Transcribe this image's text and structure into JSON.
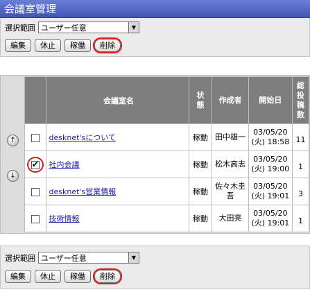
{
  "title": "会議室管理",
  "range": {
    "label": "選択範囲",
    "value": "ユーザー任意"
  },
  "actions": {
    "edit": "編集",
    "pause": "休止",
    "run": "稼働",
    "delete": "削除"
  },
  "table": {
    "headers": {
      "name": "会議室名",
      "status": "状態",
      "author": "作成者",
      "start": "開始日",
      "count": "総投稿数"
    },
    "rows": [
      {
        "name": "desknet'sについて",
        "status": "稼動",
        "author": "田中雄一",
        "date": "03/05/20",
        "time": "(火) 18:58",
        "count": "11",
        "checked": false
      },
      {
        "name": "社内会議",
        "status": "稼動",
        "author": "松木高志",
        "date": "03/05/20",
        "time": "(火) 19:00",
        "count": "1",
        "checked": true
      },
      {
        "name": "desknet's営業情報",
        "status": "稼動",
        "author": "佐々木圭吾",
        "date": "03/05/20",
        "time": "(火) 19:01",
        "count": "3",
        "checked": false
      },
      {
        "name": "技術情報",
        "status": "稼動",
        "author": "大田亮",
        "date": "03/05/20",
        "time": "(火) 19:01",
        "count": "1",
        "checked": false
      }
    ]
  },
  "icons": {
    "up": "up-arrow-icon",
    "down": "down-arrow-icon",
    "dropdown": "chevron-down-icon"
  },
  "colors": {
    "header_bar": "#4f63c6",
    "table_header": "#7e7e7e",
    "highlight_ring": "#e01a1a",
    "link": "#1a1aa6"
  }
}
